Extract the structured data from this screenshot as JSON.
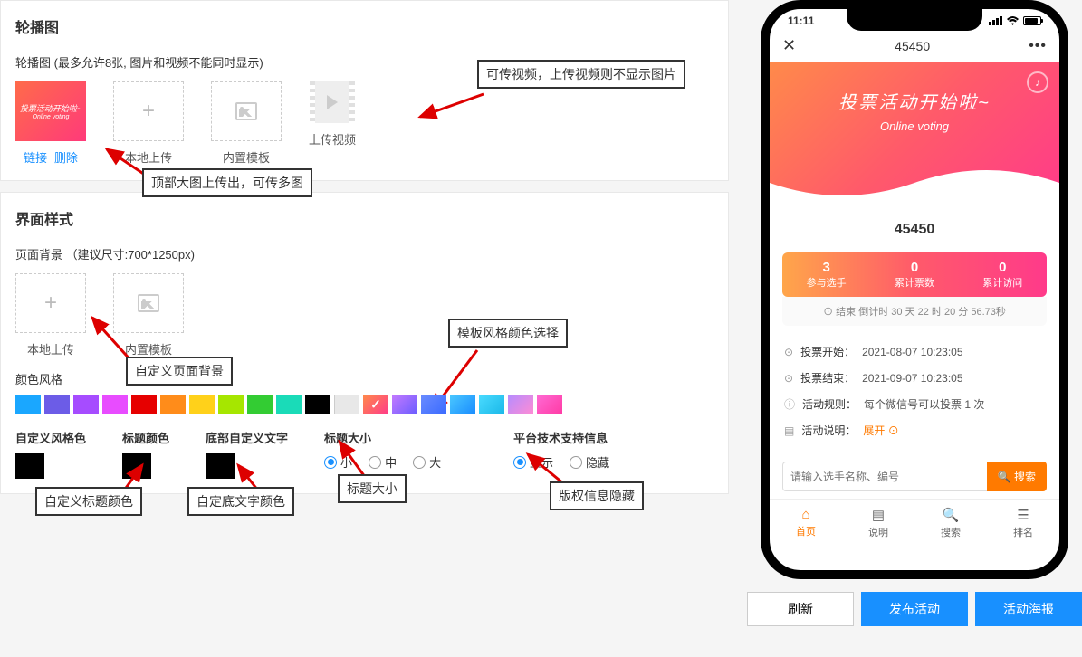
{
  "carousel": {
    "title": "轮播图",
    "subtitle": "轮播图 (最多允许8张, 图片和视频不能同时显示)",
    "thumb": {
      "line1": "投票活动开始啦~",
      "line2": "Online voting"
    },
    "link_label": "链接",
    "delete_label": "删除",
    "local_upload": "本地上传",
    "builtin_tpl": "内置模板",
    "upload_video": "上传视频",
    "ann_video": "可传视频，上传视频则不显示图片",
    "ann_multi": "顶部大图上传出，可传多图"
  },
  "style": {
    "title": "界面样式",
    "bg_label": "页面背景 （建议尺寸:700*1250px)",
    "local_upload": "本地上传",
    "builtin_tpl": "内置模板",
    "ann_bg": "自定义页面背景",
    "color_label": "颜色风格",
    "ann_palette": "模板风格颜色选择",
    "colors": [
      "#1aa7ff",
      "#6c5ce7",
      "#a64cff",
      "#e84cff",
      "#e60000",
      "#ff8c1a",
      "#ffd11a",
      "#a6e600",
      "#33cc33",
      "#1adbb8",
      "#000000",
      "#e8e8e8",
      "linear-gradient(135deg,#ff8a4a,#ff3a8a)",
      "linear-gradient(135deg,#c47aff,#6a5cff)",
      "linear-gradient(135deg,#6a8cff,#3a6aff)",
      "linear-gradient(135deg,#4ac8ff,#1a8cff)",
      "linear-gradient(135deg,#4adbff,#1ab8e8)",
      "linear-gradient(135deg,#b58cff,#ff8cd4)",
      "linear-gradient(135deg,#ff6ad4,#ff3aa4)"
    ],
    "checked_index": 12,
    "custom_color": "自定义风格色",
    "title_color": "标题颜色",
    "bottom_text": "底部自定义文字",
    "title_size": "标题大小",
    "size_opts": [
      "小",
      "中",
      "大"
    ],
    "size_sel": 0,
    "platform_info": "平台技术支持信息",
    "show_opts": [
      "显示",
      "隐藏"
    ],
    "show_sel": 0,
    "ann_title_color": "自定义标题颜色",
    "ann_bottom_color": "自定底文字颜色",
    "ann_title_size": "标题大小",
    "ann_copyright": "版权信息隐藏"
  },
  "phone": {
    "time": "11:11",
    "nav_title": "45450",
    "hero_title": "投票活动开始啦~",
    "hero_sub": "Online voting",
    "mini_title": "45450",
    "stats": [
      {
        "num": "3",
        "txt": "参与选手"
      },
      {
        "num": "0",
        "txt": "累计票数"
      },
      {
        "num": "0",
        "txt": "累计访问"
      }
    ],
    "countdown": "⊙ 结束 倒计时 30 天 22 时 20 分 56.73秒",
    "info": [
      {
        "ico": "⊙",
        "label": "投票开始：",
        "val": "2021-08-07 10:23:05"
      },
      {
        "ico": "⊙",
        "label": "投票结束：",
        "val": "2021-09-07 10:23:05"
      },
      {
        "ico": "ⓘ",
        "label": "活动规则：",
        "val": "每个微信号可以投票 1 次"
      },
      {
        "ico": "▤",
        "label": "活动说明：",
        "val": ""
      }
    ],
    "expand": "展开 ⊙",
    "search_placeholder": "请输入选手名称、编号",
    "search_btn": "🔍 搜索",
    "tabs": [
      {
        "ico": "⌂",
        "label": "首页",
        "active": true
      },
      {
        "ico": "▤",
        "label": "说明"
      },
      {
        "ico": "🔍",
        "label": "搜索"
      },
      {
        "ico": "☰",
        "label": "排名"
      }
    ]
  },
  "bottom": {
    "refresh": "刷新",
    "publish": "发布活动",
    "poster": "活动海报"
  }
}
